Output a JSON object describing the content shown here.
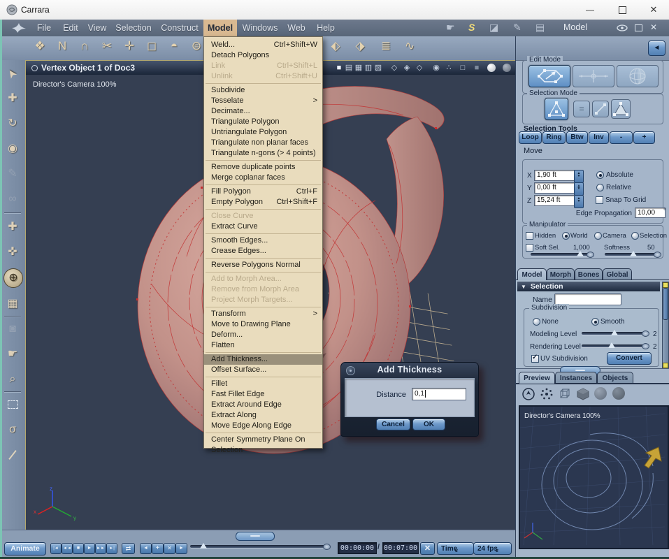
{
  "titlebar": {
    "title": "Carrara",
    "minimize": "—",
    "close": "✕"
  },
  "menubar": {
    "items": [
      "File",
      "Edit",
      "View",
      "Selection",
      "Construct",
      "Model",
      "Windows",
      "Web",
      "Help"
    ],
    "active_item": "Model",
    "room_label": "Model"
  },
  "model_menu": {
    "items": [
      {
        "label": "Weld...",
        "shortcut": "Ctrl+Shift+W"
      },
      {
        "label": "Detach Polygons"
      },
      {
        "label": "Link",
        "shortcut": "Ctrl+Shift+L",
        "disabled": true
      },
      {
        "label": "Unlink",
        "shortcut": "Ctrl+Shift+U",
        "disabled": true
      },
      {
        "separator": true
      },
      {
        "label": "Subdivide"
      },
      {
        "label": "Tesselate",
        "submenu": true
      },
      {
        "label": "Decimate..."
      },
      {
        "label": "Triangulate Polygon"
      },
      {
        "label": "Untriangulate Polygon"
      },
      {
        "label": "Triangulate non planar faces"
      },
      {
        "label": "Triangulate n-gons (> 4 points)"
      },
      {
        "separator": true
      },
      {
        "label": "Remove duplicate points"
      },
      {
        "label": "Merge coplanar faces"
      },
      {
        "separator": true
      },
      {
        "label": "Fill Polygon",
        "shortcut": "Ctrl+F"
      },
      {
        "label": "Empty Polygon",
        "shortcut": "Ctrl+Shift+F"
      },
      {
        "separator": true
      },
      {
        "label": "Close Curve",
        "disabled": true
      },
      {
        "label": "Extract Curve"
      },
      {
        "separator": true
      },
      {
        "label": "Smooth Edges..."
      },
      {
        "label": "Crease Edges..."
      },
      {
        "separator": true
      },
      {
        "label": "Reverse Polygons Normal"
      },
      {
        "separator": true
      },
      {
        "label": "Add to Morph Area...",
        "disabled": true
      },
      {
        "label": "Remove from Morph Area",
        "disabled": true
      },
      {
        "label": "Project Morph Targets...",
        "disabled": true
      },
      {
        "separator": true
      },
      {
        "label": "Transform",
        "submenu": true
      },
      {
        "label": "Move to Drawing Plane"
      },
      {
        "label": "Deform..."
      },
      {
        "label": "Flatten"
      },
      {
        "separator": true
      },
      {
        "label": "Add Thickness...",
        "highlighted": true
      },
      {
        "label": "Offset Surface..."
      },
      {
        "separator": true
      },
      {
        "label": "Fillet"
      },
      {
        "label": "Fast Fillet Edge"
      },
      {
        "label": "Extract Around Edge"
      },
      {
        "label": "Extract Along"
      },
      {
        "label": "Move Edge Along Edge"
      },
      {
        "separator": true
      },
      {
        "label": "Center Symmetry Plane On Selection"
      }
    ]
  },
  "viewport": {
    "title": "Vertex Object 1 of Doc3",
    "camera_label": "Director's Camera 100%"
  },
  "dialog": {
    "title": "Add Thickness",
    "distance_label": "Distance",
    "distance_value": "0,1",
    "cancel": "Cancel",
    "ok": "OK"
  },
  "panel": {
    "edit_mode": "Edit Mode",
    "selection_mode": "Selection Mode",
    "selection_tools": "Selection Tools",
    "tools": [
      "Loop",
      "Ring",
      "Btw",
      "Inv",
      "-",
      "+"
    ],
    "move": {
      "title": "Move",
      "x": "X",
      "y": "Y",
      "z": "Z",
      "x_val": "1,90 ft",
      "y_val": "0,00 ft",
      "z_val": "15,24 ft",
      "absolute": "Absolute",
      "relative": "Relative",
      "snap": "Snap To Grid",
      "edge_prop": "Edge Propagation",
      "edge_prop_val": "10,00",
      "deg": "°"
    },
    "manipulator": {
      "title": "Manipulator",
      "hidden": "Hidden",
      "world": "World",
      "camera": "Camera",
      "selection": "Selection",
      "soft_sel": "Soft Sel.",
      "soft_val": "1,000",
      "softness": "Softness",
      "softness_val": "50"
    },
    "tabs": [
      "Model",
      "Morph",
      "Bones",
      "Global"
    ],
    "selection": {
      "header": "Selection",
      "name": "Name",
      "name_value": "",
      "subdivision": "Subdivision",
      "none": "None",
      "smooth": "Smooth",
      "modeling": "Modeling Level",
      "modeling_val": "2",
      "rendering": "Rendering Level",
      "rendering_val": "2",
      "uv": "UV Subdivision",
      "convert": "Convert"
    },
    "preview_tabs": [
      "Preview",
      "Instances",
      "Objects"
    ],
    "preview": {
      "camera_label": "Director's Camera 100%"
    }
  },
  "bottom": {
    "animate": "Animate",
    "current": "00:00:00",
    "slash": "/",
    "total": "00:07:00",
    "time_mode": "Time",
    "fps": "24 fps"
  },
  "colors": {
    "accent_blue": "#6d99ca",
    "menu_tan": "#e9dcbd",
    "menu_highlight": "#9a907b",
    "menubar_active_tan": "#d9b991",
    "viewport_bg": "#353f52",
    "shell_salmon": "#c29189",
    "wire_red": "#c23232",
    "panel_bg": "#a5b5c9"
  },
  "icons": {
    "submenu_arrow": ">",
    "tools_left": [
      "❖",
      "N",
      "∩",
      "✂",
      "✛",
      "◻",
      "◓",
      "⊜"
    ],
    "tools_right": [
      "⬖",
      "⬗",
      "≣",
      "∿"
    ],
    "rooms": [
      "☛",
      "S",
      "◪",
      "✎",
      "▤"
    ],
    "header_layouts": [
      "■",
      "▤",
      "▦",
      "▥",
      "▧"
    ],
    "header_shields": [
      "◇",
      "◈",
      "◇"
    ],
    "header_circles": [
      "◉",
      "∴",
      "□",
      "■"
    ],
    "side_tools": [
      {
        "name": "select-tool",
        "glyph": "➤"
      },
      {
        "name": "move-tool",
        "glyph": "✚"
      },
      {
        "name": "rotate-tool",
        "glyph": "↻"
      },
      {
        "name": "scale-tool",
        "glyph": "◉"
      },
      {
        "name": "pen-tool",
        "glyph": "✎"
      },
      {
        "name": "link-tool",
        "glyph": "∞"
      },
      {
        "name": "translate-tool",
        "glyph": "✚"
      },
      {
        "name": "translate-rotate-tool",
        "glyph": "✜"
      },
      {
        "name": "universal-manipulator",
        "glyph": "⊕"
      },
      {
        "name": "uv-box-tool",
        "glyph": "▦"
      },
      {
        "name": "camera-tool",
        "glyph": "◙"
      },
      {
        "name": "pan-tool",
        "glyph": "☛"
      },
      {
        "name": "zoom-tool",
        "glyph": "⌕"
      }
    ],
    "lasso_glyph": "σ",
    "transport": [
      "|◄",
      "◄◄",
      "■",
      "►",
      "►►",
      "►|"
    ],
    "loop": "⇄",
    "keyframe": [
      "◄",
      "+",
      "✕",
      "►"
    ],
    "x_button": "✕",
    "chevron": "»",
    "back_arrow": "◄",
    "sel_eq": "=",
    "step_up": "▲",
    "step_down": "▼",
    "collapse_triangle": "▼"
  }
}
